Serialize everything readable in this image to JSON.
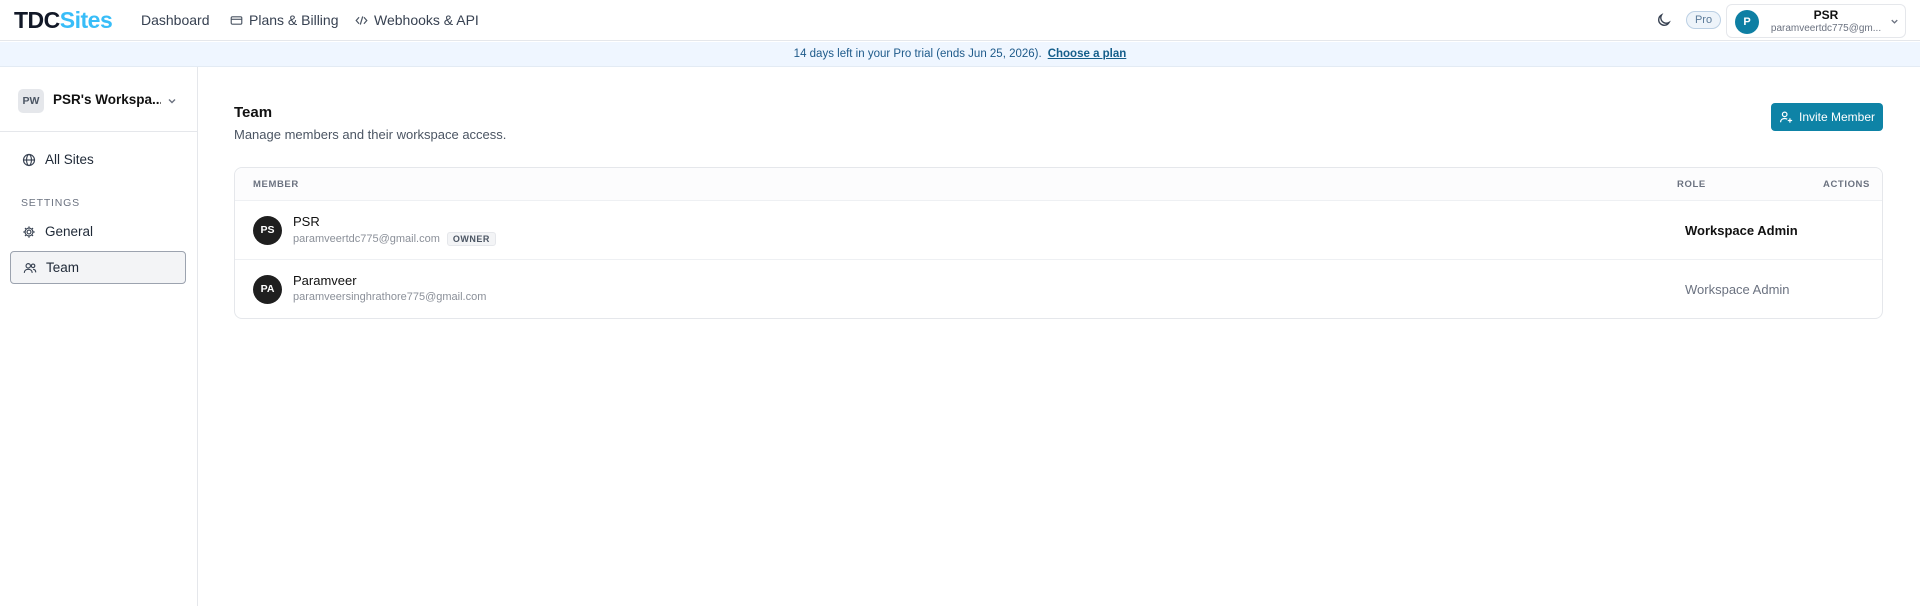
{
  "brand": {
    "part1": "TDC",
    "part2": "Sites"
  },
  "nav": {
    "dashboard": "Dashboard",
    "plans": "Plans & Billing",
    "webhooks": "Webhooks & API"
  },
  "header": {
    "plan_badge": "Pro",
    "user": {
      "initial": "P",
      "name": "PSR",
      "email": "paramveertdc775@gm..."
    }
  },
  "banner": {
    "text": "14 days left in your Pro trial (ends Jun 25, 2026).",
    "link": "Choose a plan"
  },
  "sidebar": {
    "workspace": {
      "initials": "PW",
      "name": "PSR's Workspa..."
    },
    "all_sites": "All Sites",
    "section_label": "SETTINGS",
    "general": "General",
    "team": "Team"
  },
  "main": {
    "title": "Team",
    "subtitle": "Manage members and their workspace access.",
    "invite_label": "Invite Member",
    "columns": {
      "member": "MEMBER",
      "role": "ROLE",
      "actions": "ACTIONS"
    },
    "members": [
      {
        "initials": "PS",
        "name": "PSR",
        "email": "paramveertdc775@gmail.com",
        "badge": "OWNER",
        "role": "Workspace Admin"
      },
      {
        "initials": "PA",
        "name": "Paramveer",
        "email": "paramveersinghrathore775@gmail.com",
        "role": "Workspace Admin"
      }
    ]
  },
  "colors": {
    "accent": "#0e83a6",
    "brand_accent": "#38bdf8",
    "banner_bg": "#eff6ff"
  }
}
